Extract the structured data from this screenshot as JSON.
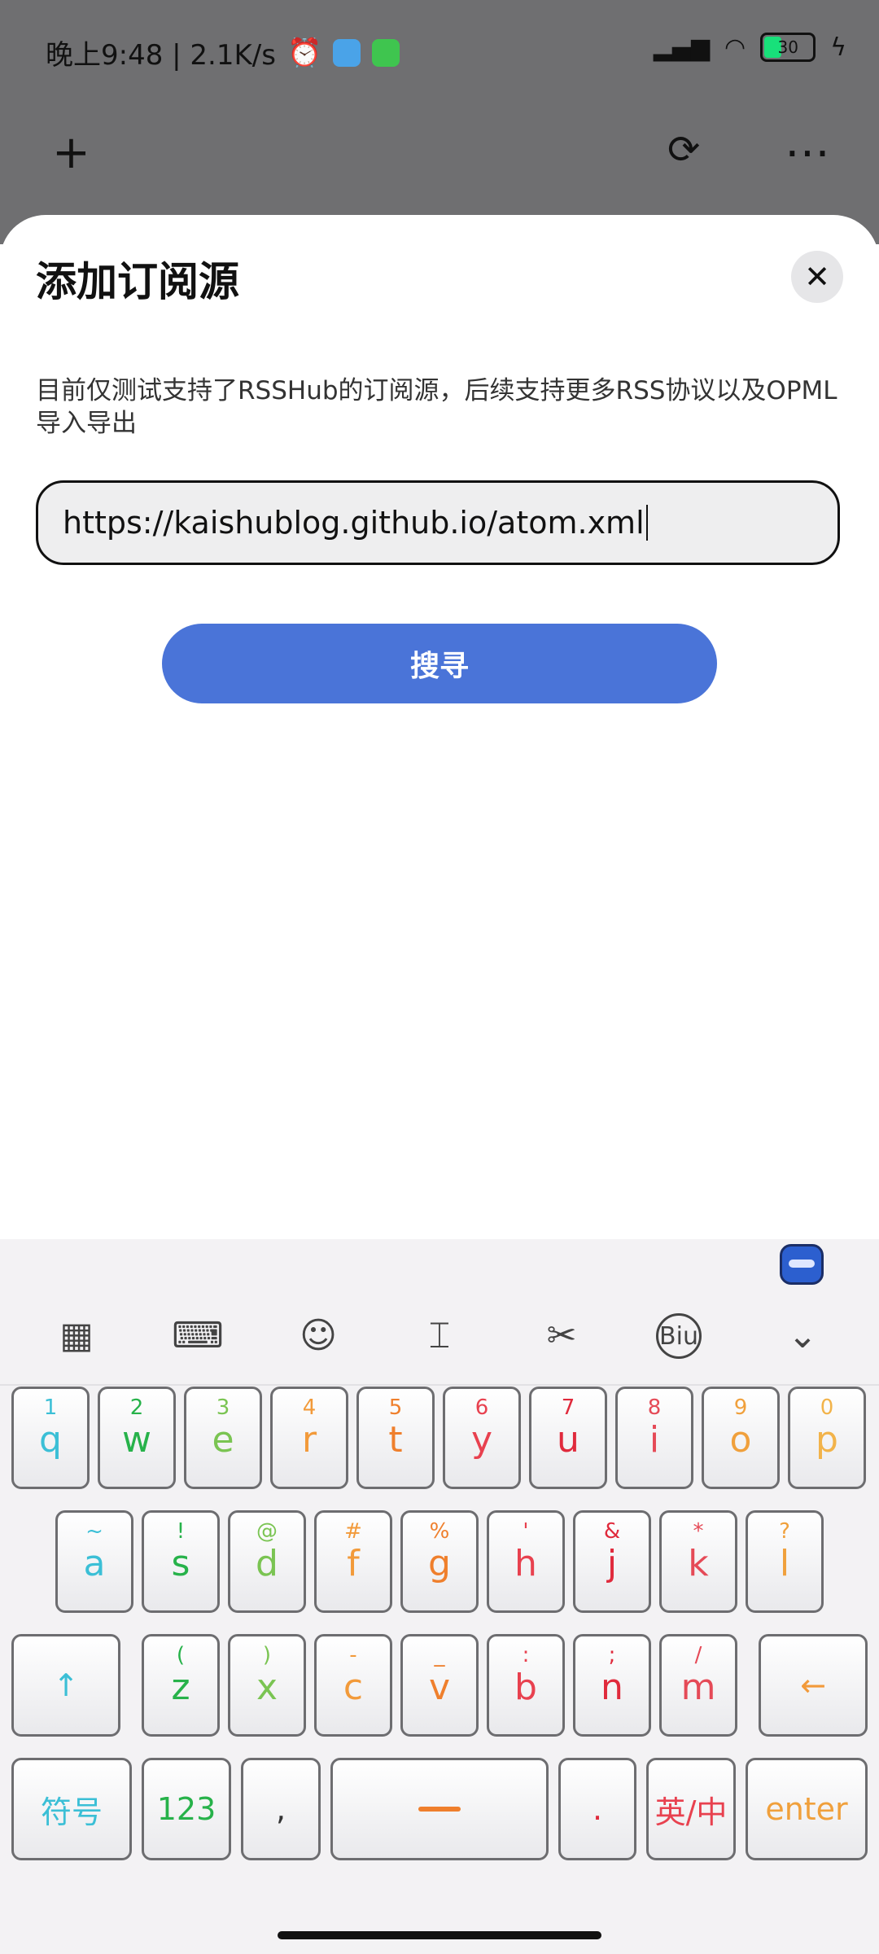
{
  "status_bar": {
    "time_speed": "晚上9:48 | 2.1K/s",
    "battery": "30"
  },
  "dialog": {
    "title": "添加订阅源",
    "close_icon": "close-icon",
    "description": "目前仅测试支持了RSSHub的订阅源，后续支持更多RSS协议以及OPML导入导出",
    "url_value": "https://kaishublog.github.io/atom.xml",
    "search_label": "搜寻",
    "accent_color": "#4a74d8"
  },
  "keyboard": {
    "row1": [
      {
        "top": "1",
        "main": "q",
        "color": "#3bbfd6"
      },
      {
        "top": "2",
        "main": "w",
        "color": "#27b24a"
      },
      {
        "top": "3",
        "main": "e",
        "color": "#7ac452"
      },
      {
        "top": "4",
        "main": "r",
        "color": "#f29a3a"
      },
      {
        "top": "5",
        "main": "t",
        "color": "#ef7f2c"
      },
      {
        "top": "6",
        "main": "y",
        "color": "#e8414f"
      },
      {
        "top": "7",
        "main": "u",
        "color": "#e02a3c"
      },
      {
        "top": "8",
        "main": "i",
        "color": "#e54a57"
      },
      {
        "top": "9",
        "main": "o",
        "color": "#f0a03c"
      },
      {
        "top": "0",
        "main": "p",
        "color": "#f2b34a"
      }
    ],
    "row2": [
      {
        "top": "~",
        "main": "a",
        "color": "#3bbfd6"
      },
      {
        "top": "!",
        "main": "s",
        "color": "#27b24a"
      },
      {
        "top": "@",
        "main": "d",
        "color": "#7ac452"
      },
      {
        "top": "#",
        "main": "f",
        "color": "#f29a3a"
      },
      {
        "top": "%",
        "main": "g",
        "color": "#ef7f2c"
      },
      {
        "top": "'",
        "main": "h",
        "color": "#e8414f"
      },
      {
        "top": "&",
        "main": "j",
        "color": "#e02a3c"
      },
      {
        "top": "*",
        "main": "k",
        "color": "#e54a57"
      },
      {
        "top": "?",
        "main": "l",
        "color": "#f0a03c"
      }
    ],
    "row3": [
      {
        "top": "(",
        "main": "z",
        "color": "#27b24a"
      },
      {
        "top": ")",
        "main": "x",
        "color": "#7ac452"
      },
      {
        "top": "-",
        "main": "c",
        "color": "#f29a3a"
      },
      {
        "top": "_",
        "main": "v",
        "color": "#ef7f2c"
      },
      {
        "top": ":",
        "main": "b",
        "color": "#e8414f"
      },
      {
        "top": ";",
        "main": "n",
        "color": "#e02a3c"
      },
      {
        "top": "/",
        "main": "m",
        "color": "#e54a57"
      }
    ],
    "shift_glyph": "↑",
    "backspace_glyph": "←",
    "symbols_label": "符号",
    "numbers_label": "123",
    "comma_label": ",",
    "period_label": ".",
    "lang_label": "英/中",
    "enter_label": "enter"
  }
}
